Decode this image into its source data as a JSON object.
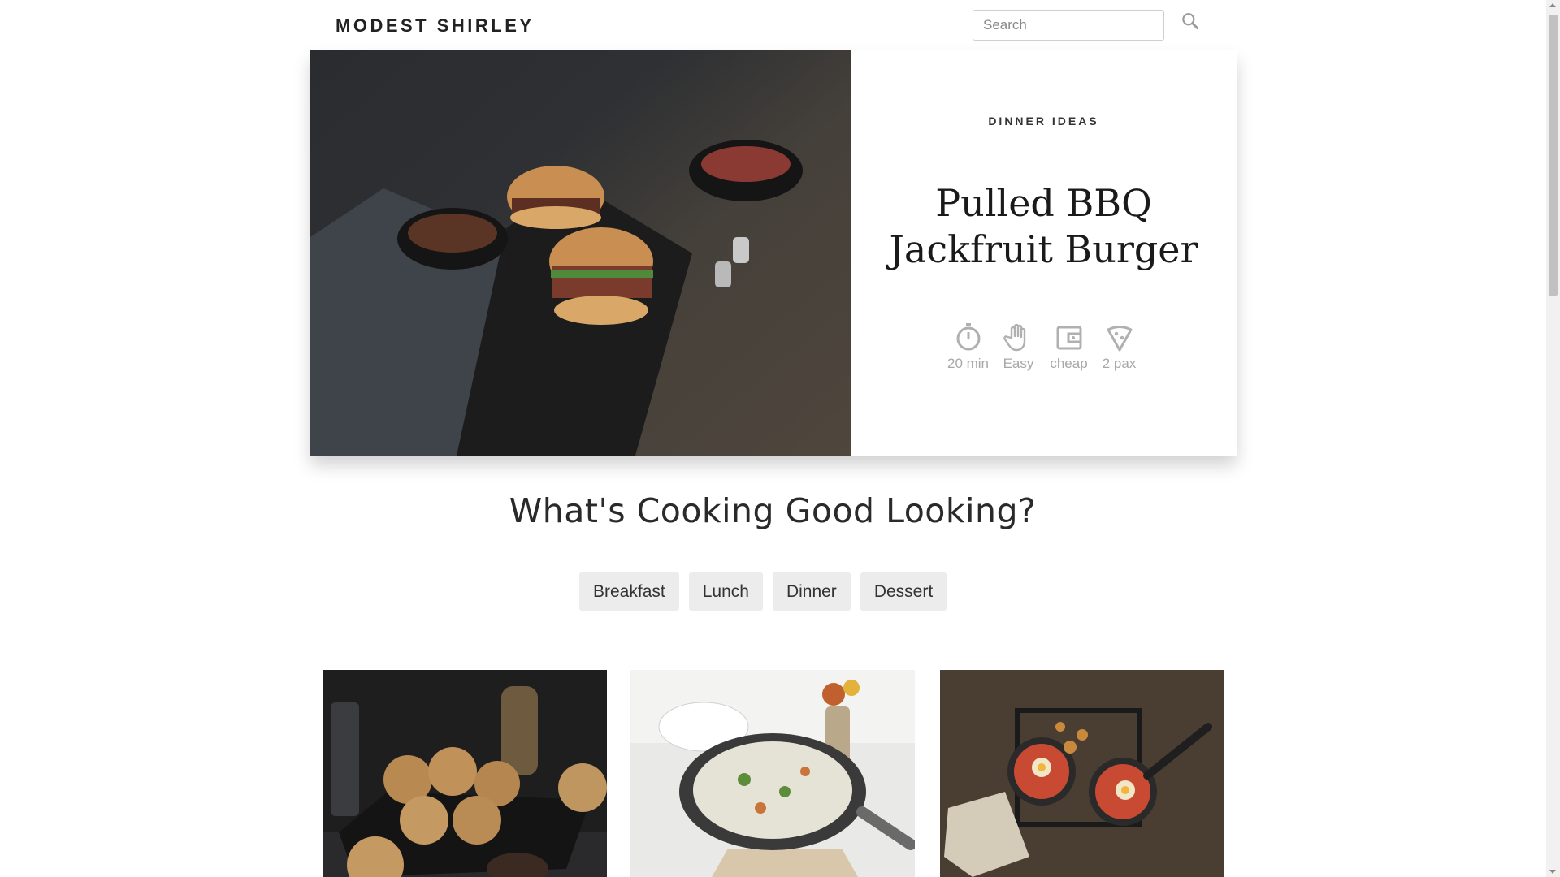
{
  "header": {
    "brand": "MODEST SHIRLEY",
    "search_placeholder": "Search"
  },
  "hero": {
    "category": "DINNER IDEAS",
    "title_line1": "Pulled BBQ",
    "title_line2": "Jackfruit Burger",
    "meta": [
      {
        "icon": "timer-icon",
        "label": "20 min"
      },
      {
        "icon": "hand-icon",
        "label": "Easy"
      },
      {
        "icon": "wallet-icon",
        "label": "cheap"
      },
      {
        "icon": "pizza-slice-icon",
        "label": "2 pax"
      }
    ]
  },
  "section": {
    "heading": "What's Cooking Good Looking?",
    "filters": [
      "Breakfast",
      "Lunch",
      "Dinner",
      "Dessert"
    ]
  },
  "colors": {
    "accent_text": "#222222",
    "meta_gray": "#a8a8a8",
    "filter_bg": "#ececec"
  }
}
